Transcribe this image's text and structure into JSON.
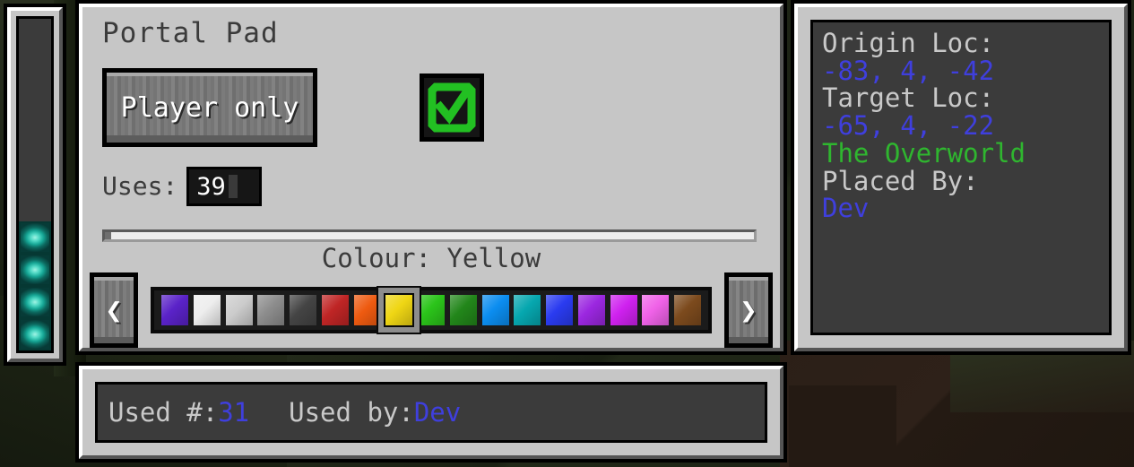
{
  "window": {
    "title": "Portal Pad"
  },
  "energy_bar": {
    "name": "energy-meter",
    "filled_cells": 4,
    "total_cells": 11,
    "cell_color": "#16a695"
  },
  "portal_pad": {
    "title": "Portal Pad",
    "mode_button": {
      "label": "Player only"
    },
    "confirm_toggle": {
      "icon": "check-circle-icon",
      "color": "#22c022",
      "state": "enabled"
    },
    "uses": {
      "label": "Uses:",
      "value": "39",
      "caret": true
    },
    "colour": {
      "caption": "Colour: Yellow",
      "selected_index": 7,
      "selected_name": "Yellow",
      "swatches": [
        {
          "name": "Purple",
          "hex": "#5a22c8"
        },
        {
          "name": "White",
          "hex": "#eeeeee"
        },
        {
          "name": "Light Gray",
          "hex": "#cccccc"
        },
        {
          "name": "Gray",
          "hex": "#8d8d8d"
        },
        {
          "name": "Dark Gray",
          "hex": "#444444"
        },
        {
          "name": "Red",
          "hex": "#bf2525"
        },
        {
          "name": "Orange",
          "hex": "#ee5a10"
        },
        {
          "name": "Yellow",
          "hex": "#efd614"
        },
        {
          "name": "Lime",
          "hex": "#2bc41a"
        },
        {
          "name": "Green",
          "hex": "#22861a"
        },
        {
          "name": "Light Blue",
          "hex": "#0b8df0"
        },
        {
          "name": "Cyan",
          "hex": "#06a7af"
        },
        {
          "name": "Blue",
          "hex": "#2a3bf0"
        },
        {
          "name": "Purple 2",
          "hex": "#9b27e0"
        },
        {
          "name": "Magenta",
          "hex": "#cf21ef"
        },
        {
          "name": "Pink",
          "hex": "#f062e8"
        },
        {
          "name": "Brown",
          "hex": "#7c4a1d"
        }
      ]
    },
    "prev_button": {
      "glyph": "❮",
      "icon": "chevron-left-icon"
    },
    "next_button": {
      "glyph": "❯",
      "icon": "chevron-right-icon"
    }
  },
  "info_panel": {
    "origin_label": "Origin Loc:",
    "origin_value": "-83, 4, -42",
    "target_label": "Target Loc:",
    "target_value": "-65, 4, -22",
    "target_dimension": "The Overworld",
    "placed_by_label": "Placed By:",
    "placed_by_value": "Dev"
  },
  "usage_bar": {
    "used_count_label": "Used #:",
    "used_count_value": "31",
    "used_by_label": "Used by:",
    "used_by_value": "Dev"
  },
  "colors": {
    "panel_bg": "#c6c6c6",
    "dark_box": "#3b3b3b",
    "text_dark": "#3b3b3b",
    "text_light": "#c9c9c9",
    "value_blue": "#3f3fdd",
    "dimension_green": "#2fb62f"
  }
}
